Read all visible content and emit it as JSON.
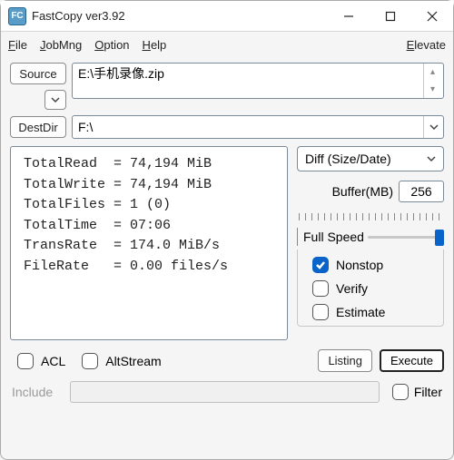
{
  "window": {
    "title": "FastCopy ver3.92",
    "icon_text": "FC"
  },
  "menu": {
    "file": "File",
    "jobmng": "JobMng",
    "option": "Option",
    "help": "Help",
    "elevate": "Elevate"
  },
  "source": {
    "button": "Source",
    "path": "E:\\手机录像.zip"
  },
  "dest": {
    "button": "DestDir",
    "path": "F:\\"
  },
  "stats": {
    "text": "TotalRead  = 74,194 MiB\nTotalWrite = 74,194 MiB\nTotalFiles = 1 (0)\nTotalTime  = 07:06\nTransRate  = 174.0 MiB/s\nFileRate   = 0.00 files/s"
  },
  "mode": {
    "selected": "Diff (Size/Date)"
  },
  "buffer": {
    "label": "Buffer(MB)",
    "value": "256"
  },
  "speed": {
    "label": "Full Speed"
  },
  "checks": {
    "nonstop": "Nonstop",
    "verify": "Verify",
    "estimate": "Estimate",
    "acl": "ACL",
    "altstream": "AltStream",
    "filter": "Filter"
  },
  "buttons": {
    "listing": "Listing",
    "execute": "Execute"
  },
  "include": {
    "label": "Include"
  }
}
